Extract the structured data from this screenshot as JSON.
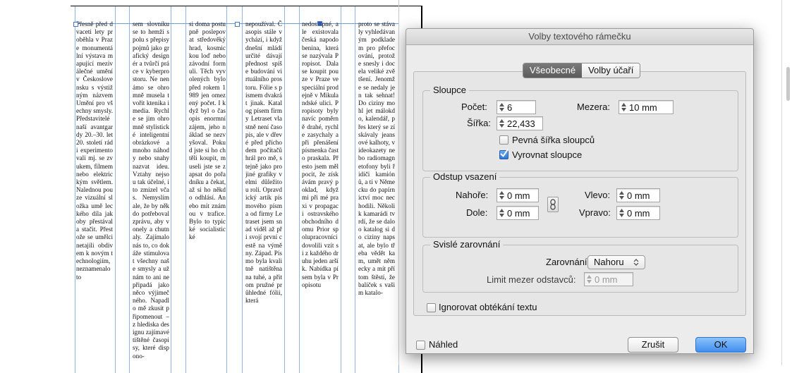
{
  "document": {
    "columns": [
      "Přesně před dvaceti lety proběhla v Praze monumentální výstava mapující meziválečné umění v Československu s výstižným názvem Umění pro všechny smysly. Představitelé naší avantgardy 20.–30. let 20. století rádi experimentovali mj. se zvukem, filmem nebo elektrickým světlem. Nalednou pouze vizuální složka umě leckého díla jakoby přestávala stačit. Přestože se umělci netajili obdivem k novým technologiím, neznamenalo to",
      "sem slovníku se to hemží spolu s přepisy pojmů jako grafický designér a tvůrčí práce v kyberprostoru. Ne nenámo se ohromně musela tvořit ktenika i media. Rychle se jim ohromně stylistické inteligentní obrázkové a mnoho náhody nebo snahy nazvat ideu. Vztahy nejsou tak účelné, i to zmizel včas. Nemyslím ale, že by někdo potřeboval zprávu, aby vonely a chutnaly. Zajímalo nás to, co dokáže stimulovat všechny naše smysly a už nám to ani nepřipadá jako něco výjimečného. Napadlo mě zkusit připomenout – z hlediska designu zajímavé tištěné časopisy, které dispono-",
      "si doma postupně poslepovat středověký hrad, kosmickou loď nebo závodní formuli. Těch vyvolených bylo před rokem 1989 jen omezený počet. I když byl o časopis enormní zájem, jeho náklad se nezvyšoval. Pokud jste si ho chtěli koupit, museli jste se zapsat do pořadníku a čekat, až si ho někdo odhlásí. Anebo mít známou v trafice. Bylo to typické socialistické",
      "nepoužíval. Časopis stále vychází, i když dnešní mládí určité dávají přednost spíše budování virtuálního prostoru. Fólie s písmem dvakrát jinak. Katalog písem firmy Letraset vlastně není časopis, ale v dřevé před příchodem počítačů hrál pro mě, stejně jako pro jiné grafiky velmi důležitou roli. Opravdický artík písmového písma od firmy Letraset jsem snad viděl až při svojí první cestě na výměny. Západ. Písmo byla kvalitně natištěna na tuhé, a přitom pružné průhledné fólii, která",
      "nedostupné, ale existovala česká napodobenina, která se nazývala Propisot. Dala se koupit pouze v Praze ve speciální prodejně v Mikulandské ulici. Propisoty byly navíc poměrně drahé, rychle zasychaly a při přenášení písmenka často praskala. Přesto jsem měl pocit, že získávám pravý poklad, když mi při mé praxi v propagaci ostravského obchodního domu Prior spolupracovníci dovolili vzít si z každého druhu jeden aršík. Nabídka písem byla v Propisotu",
      "proto se stávaly vyhledávaným podkladem pro přefocování, protože snesly i docela veliké zvětšení. Jenomže se nedaly jen tak sehnat! Do ciziny mohl jet málokdo, kalendář, přes který se získávaly jeansové kalhoty, videokazety nebo radiomagnetofony byli řidiči kamiónů, a ti v Německu do papírnictví moc nechodili. Několik kamarádi tvrdí, že se dalo o katalog si do ciziny napsat, ale bylo třeba vědět kam, umět německy a mít přítom štěstí, že balíček s vašim katalo-"
    ]
  },
  "dialog": {
    "title": "Volby textového rámečku",
    "tabs": [
      "Všeobecné",
      "Volby účaří"
    ],
    "active_tab": "Všeobecné",
    "columns_group": {
      "legend": "Sloupce",
      "count_label": "Počet:",
      "count_value": "6",
      "gutter_label": "Mezera:",
      "gutter_value": "10 mm",
      "width_label": "Šířka:",
      "width_value": "22,433",
      "fixed_width_label": "Pevná šířka sloupců",
      "fixed_width_checked": false,
      "balance_label": "Vyrovnat sloupce",
      "balance_checked": true
    },
    "inset_group": {
      "legend": "Odstup vsazení",
      "top_label": "Nahoře:",
      "top_value": "0 mm",
      "bottom_label": "Dole:",
      "bottom_value": "0 mm",
      "left_label": "Vlevo:",
      "left_value": "0 mm",
      "right_label": "Vpravo:",
      "right_value": "0 mm"
    },
    "vertical_group": {
      "legend": "Svislé zarovnání",
      "align_label": "Zarovnání:",
      "align_value": "Nahoru",
      "limit_label": "Limit mezer odstavců:",
      "limit_value": "0 mm"
    },
    "ignore_wrap_label": "Ignorovat obtékání textu",
    "preview_label": "Náhled",
    "cancel_label": "Zrušit",
    "ok_label": "OK"
  },
  "colors": {
    "accent": "#3f8ef0",
    "tab_active": "#666666",
    "guide": "#6f9cd8"
  }
}
